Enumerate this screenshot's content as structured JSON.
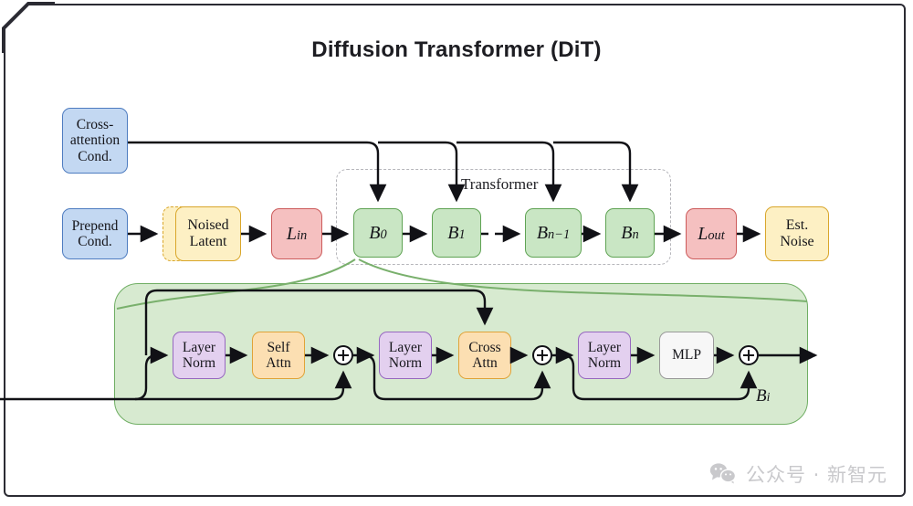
{
  "page": {
    "title": "Diffusion Transformer (DiT)",
    "background": "#ffffff",
    "frame_color": "#2b2b33"
  },
  "colors": {
    "blue_fill": "#c3d8f2",
    "blue_stroke": "#4e7cc0",
    "yellow_fill": "#fdf0c4",
    "yellow_stroke": "#d9a62b",
    "red_fill": "#f5c0c0",
    "red_stroke": "#cc5b5b",
    "green_fill": "#c9e6c4",
    "green_stroke": "#5fa354",
    "purple_fill": "#e3d0ef",
    "purple_stroke": "#9768c0",
    "orange_fill": "#fcdfb2",
    "orange_stroke": "#e0a338",
    "white_fill": "#f7f7f7",
    "white_stroke": "#9a9a9a",
    "panel_fill": "#d7ead0",
    "panel_stroke": "#6fae63",
    "dashed_group": "#b6b6bb",
    "wire": "#111116",
    "watermark": "#c9c9cc"
  },
  "top_pipeline": {
    "cross_attention_cond": {
      "line1": "Cross-",
      "line2": "attention",
      "line3": "Cond."
    },
    "prepend_cond": {
      "line1": "Prepend",
      "line2": "Cond."
    },
    "noised_latent": {
      "line1": "Noised",
      "line2": "Latent"
    },
    "l_in": {
      "base": "L",
      "sub": "in"
    },
    "blocks": [
      {
        "base": "B",
        "sub": "0"
      },
      {
        "base": "B",
        "sub": "1"
      },
      {
        "base": "B",
        "sub": "n−1"
      },
      {
        "base": "B",
        "sub": "n"
      }
    ],
    "ellipsis_connector": "dashed-arrow",
    "l_out": {
      "base": "L",
      "sub": "out"
    },
    "est_noise": {
      "line1": "Est.",
      "line2": "Noise"
    },
    "transformer_group_label": "Transformer"
  },
  "block_detail": {
    "label": {
      "base": "B",
      "sub": "i"
    },
    "nodes": [
      {
        "id": "layer-norm-1",
        "line1": "Layer",
        "line2": "Norm",
        "style": "purple"
      },
      {
        "id": "self-attn",
        "line1": "Self",
        "line2": "Attn",
        "style": "orange"
      },
      {
        "id": "add-1",
        "line1": "⊕",
        "line2": "",
        "style": "oplus"
      },
      {
        "id": "layer-norm-2",
        "line1": "Layer",
        "line2": "Norm",
        "style": "purple"
      },
      {
        "id": "cross-attn",
        "line1": "Cross",
        "line2": "Attn",
        "style": "orange"
      },
      {
        "id": "add-2",
        "line1": "⊕",
        "line2": "",
        "style": "oplus"
      },
      {
        "id": "layer-norm-3",
        "line1": "Layer",
        "line2": "Norm",
        "style": "purple"
      },
      {
        "id": "mlp",
        "line1": "MLP",
        "line2": "",
        "style": "white"
      },
      {
        "id": "add-3",
        "line1": "⊕",
        "line2": "",
        "style": "oplus"
      }
    ]
  },
  "watermark": {
    "icon": "wechat-icon",
    "text": "公众号 · 新智元"
  }
}
